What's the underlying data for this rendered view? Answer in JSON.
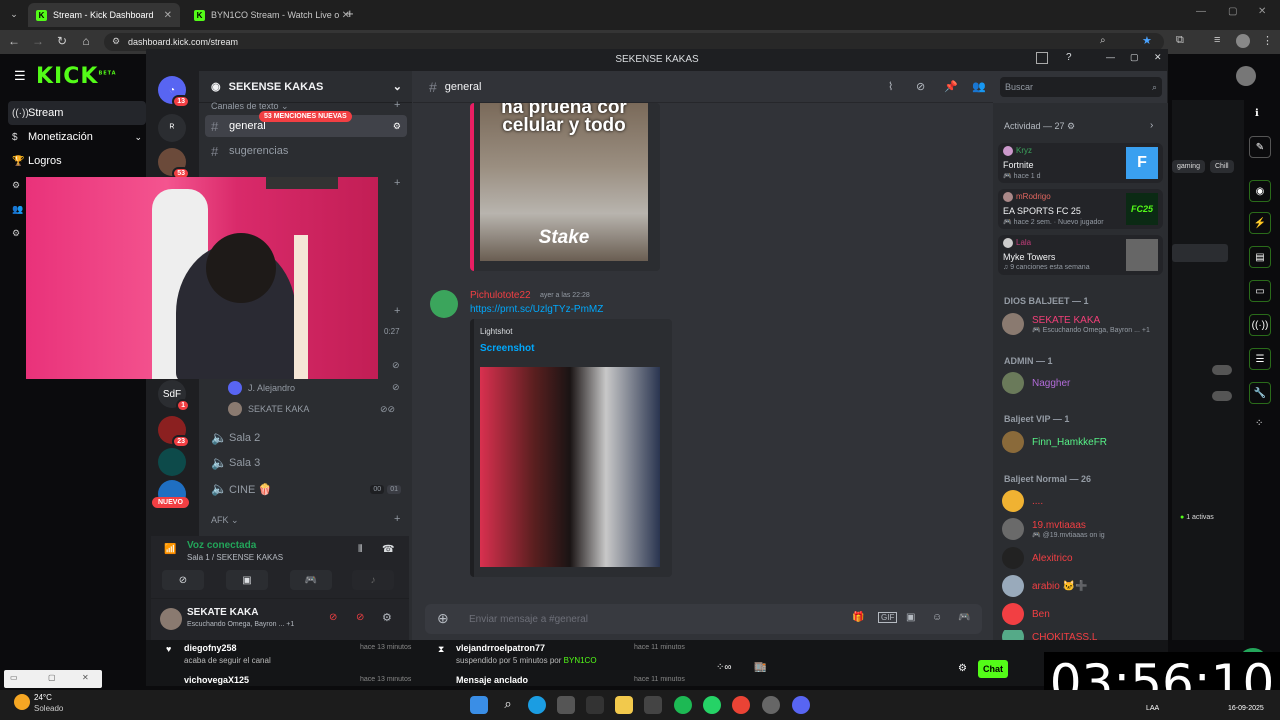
{
  "browser": {
    "tabs": [
      {
        "title": "Stream - Kick Dashboard",
        "active": true
      },
      {
        "title": "BYN1CO Stream - Watch Live o",
        "active": false
      }
    ],
    "url": "dashboard.kick.com/stream"
  },
  "kick": {
    "logo": "KICK",
    "logo_sup": "BETA",
    "sidebar": [
      {
        "label": "Stream",
        "icon": "stream-icon"
      },
      {
        "label": "Monetización",
        "icon": "dollar-icon"
      },
      {
        "label": "Logros",
        "icon": "trophy-icon"
      }
    ],
    "tags": [
      "gaming",
      "Chill"
    ],
    "active_count": "1 activas",
    "chat_button": "Chat"
  },
  "discord": {
    "window_title": "SEKENSE KAKAS",
    "server_name": "SEKENSE KAKAS",
    "category_text": "Canales de texto",
    "mentions_badge": "53 MENCIONES NUEVAS",
    "channels": [
      {
        "name": "general",
        "active": true
      },
      {
        "name": "sugerencias",
        "active": false
      }
    ],
    "timestamp_partial": "0:27",
    "voice_users": [
      "J. Alejandro",
      "SEKATE KAKA"
    ],
    "voice_channels": [
      {
        "name": "Sala 2"
      },
      {
        "name": "Sala 3"
      },
      {
        "name": "CINE 🍿",
        "counts": [
          "00",
          "01"
        ]
      }
    ],
    "afk_category": "AFK",
    "guild_badges": [
      "13",
      "53",
      "1",
      "23"
    ],
    "guild_sdf": "SdF",
    "guild_new": "NUEVO",
    "voice_connected": {
      "title": "Voz conectada",
      "subtitle": "Sala 1 / SEKENSE KAKAS"
    },
    "user": {
      "name": "SEKATE KAKA",
      "status": "Escuchando Omega, Bayron ...",
      "plus": "+1"
    },
    "chat": {
      "channel": "general",
      "embed_top_text": "celular y todo",
      "embed_top_partial": "na pruena cor",
      "embed_top_brand": "Stake",
      "message": {
        "author": "Pichulotote22",
        "time": "ayer a las 22:28",
        "link": "https://prnt.sc/UzlgTYz-PmMZ",
        "embed_provider": "Lightshot",
        "embed_title": "Screenshot"
      },
      "input_placeholder": "Enviar mensaje a #general"
    },
    "search_placeholder": "Buscar",
    "activity": {
      "header": "Actividad — 27",
      "cards": [
        {
          "user": "Kryz",
          "game": "Fortnite",
          "meta": "hace 1 d",
          "user_color": "#3ba55c",
          "thumb": "F",
          "thumb_color": "#3aa0f0"
        },
        {
          "user": "mRodrigo",
          "game": "EA SPORTS FC 25",
          "meta": "hace 2 sem.",
          "meta2": "Nuevo jugador",
          "user_color": "#e0665f",
          "thumb": "FC25",
          "thumb_color": "#0b2a14"
        },
        {
          "user": "Lala",
          "game": "Myke Towers",
          "meta": "9 canciones esta semana",
          "user_color": "#c13d7a",
          "thumb": "",
          "thumb_color": "#555"
        }
      ]
    },
    "member_sections": [
      {
        "title": "DIOS BALJEET — 1",
        "members": [
          {
            "name": "SEKATE KAKA",
            "sub": "Escuchando Omega, Bayron ...",
            "plus": "+1",
            "color": "#f23f78"
          }
        ]
      },
      {
        "title": "ADMIN — 1",
        "members": [
          {
            "name": "Naggher",
            "sub": "",
            "color": "#b26cd9"
          }
        ]
      },
      {
        "title": "Baljeet VIP — 1",
        "members": [
          {
            "name": "Finn_HamkkeFR",
            "sub": "",
            "color": "#57f287"
          }
        ]
      },
      {
        "title": "Baljeet Normal — 26",
        "members": [
          {
            "name": "....",
            "sub": "",
            "color": "#f23f43"
          },
          {
            "name": "19.mvtiaaas",
            "sub": "@19.mvtiaaas on ig",
            "color": "#f23f43"
          },
          {
            "name": "Alexitrico",
            "sub": "",
            "color": "#f23f43"
          },
          {
            "name": "arabio 🐱➕",
            "sub": "",
            "color": "#f23f43"
          },
          {
            "name": "Ben",
            "sub": "",
            "color": "#f23f43"
          },
          {
            "name": "CHOKITASS.L",
            "sub": "",
            "color": "#f23f43"
          }
        ]
      }
    ]
  },
  "bottom_feed": [
    {
      "user": "diegofny258",
      "text": "acaba de seguir el canal",
      "time": "hace 13 minutos"
    },
    {
      "user": "vlejandrroelpatron77",
      "text": "suspendido por 5 minutos por",
      "by": "BYN1CO",
      "time": "hace 11 minutos"
    },
    {
      "user": "vichovegaX125",
      "text": "",
      "time": "hace 13 minutos"
    },
    {
      "user": "Mensaje anclado",
      "text": "",
      "time": "hace 11 minutos"
    }
  ],
  "timer": "03:56:10",
  "weather": {
    "temp": "24°C",
    "desc": "Soleado"
  },
  "taskbar_right": {
    "lang": "LAA",
    "date": "16-09-2025"
  },
  "colors": {
    "kick_green": "#53fc18",
    "discord_bg": "#313338",
    "link": "#00a8fc"
  }
}
